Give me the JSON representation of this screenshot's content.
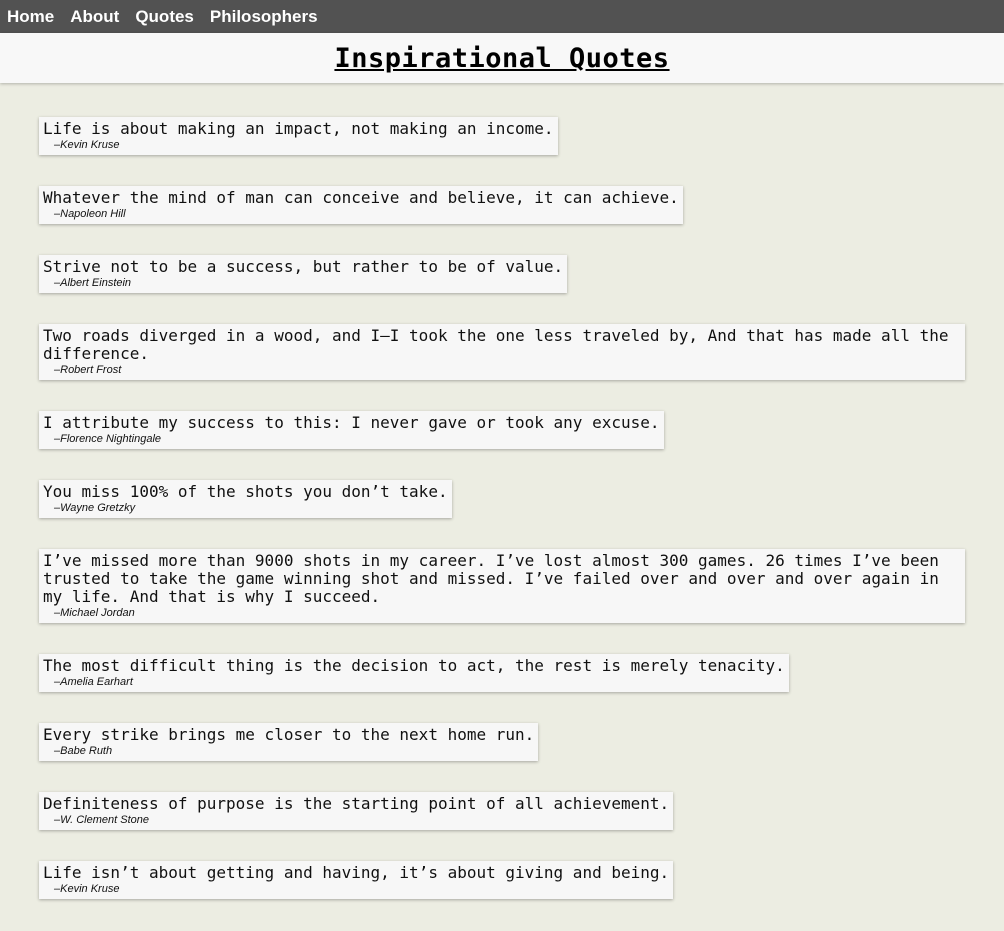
{
  "nav": {
    "items": [
      {
        "label": "Home"
      },
      {
        "label": "About"
      },
      {
        "label": "Quotes"
      },
      {
        "label": "Philosophers"
      }
    ]
  },
  "header": {
    "title": "Inspirational Quotes"
  },
  "quotes": [
    {
      "text": "Life is about making an impact, not making an income.",
      "author": "Kevin Kruse"
    },
    {
      "text": "Whatever the mind of man can conceive and believe, it can achieve.",
      "author": "Napoleon Hill"
    },
    {
      "text": "Strive not to be a success, but rather to be of value.",
      "author": "Albert Einstein"
    },
    {
      "text": "Two roads diverged in a wood, and I—I took the one less traveled by, And that has made all the difference.",
      "author": "Robert Frost"
    },
    {
      "text": "I attribute my success to this: I never gave or took any excuse.",
      "author": "Florence Nightingale"
    },
    {
      "text": "You miss 100% of the shots you don’t take.",
      "author": "Wayne Gretzky"
    },
    {
      "text": "I’ve missed more than 9000 shots in my career. I’ve lost almost 300 games. 26 times I’ve been trusted to take the game winning shot and missed. I’ve failed over and over and over again in my life. And that is why I succeed.",
      "author": "Michael Jordan"
    },
    {
      "text": "The most difficult thing is the decision to act, the rest is merely tenacity.",
      "author": "Amelia Earhart"
    },
    {
      "text": "Every strike brings me closer to the next home run.",
      "author": "Babe Ruth"
    },
    {
      "text": "Definiteness of purpose is the starting point of all achievement.",
      "author": "W. Clement Stone"
    },
    {
      "text": "Life isn’t about getting and having, it’s about giving and being.",
      "author": "Kevin Kruse"
    }
  ]
}
